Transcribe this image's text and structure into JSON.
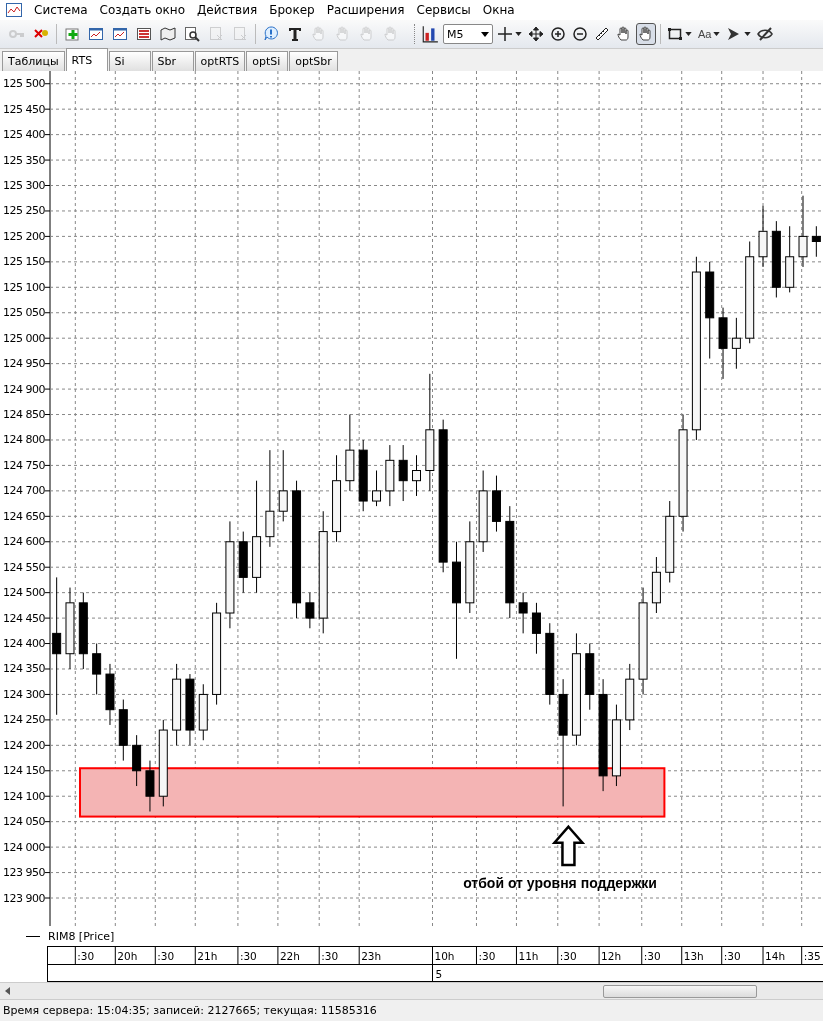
{
  "menu": [
    "Система",
    "Создать окно",
    "Действия",
    "Брокер",
    "Расширения",
    "Сервисы",
    "Окна"
  ],
  "toolbar": [
    {
      "kind": "key",
      "disabled": true
    },
    {
      "kind": "disconnect",
      "disabled": false
    },
    {
      "kind": "sep"
    },
    {
      "kind": "add",
      "disabled": false
    },
    {
      "kind": "window",
      "disabled": false
    },
    {
      "kind": "window",
      "disabled": false
    },
    {
      "kind": "list",
      "disabled": false
    },
    {
      "kind": "map",
      "disabled": false
    },
    {
      "kind": "search-doc",
      "disabled": false
    },
    {
      "kind": "doc",
      "disabled": true
    },
    {
      "kind": "doc",
      "disabled": true
    },
    {
      "kind": "sep"
    },
    {
      "kind": "alert",
      "disabled": false
    },
    {
      "kind": "text",
      "disabled": false
    },
    {
      "kind": "hand",
      "disabled": true
    },
    {
      "kind": "hand",
      "disabled": true
    },
    {
      "kind": "hand",
      "disabled": true
    },
    {
      "kind": "hand",
      "disabled": true
    }
  ],
  "chart_toolbar": {
    "timeframe": "M5",
    "tools": [
      {
        "kind": "crosshair",
        "selected": false,
        "caret": true
      },
      {
        "kind": "move",
        "selected": false,
        "caret": false
      },
      {
        "kind": "zoom-in",
        "selected": false,
        "caret": false
      },
      {
        "kind": "zoom-out",
        "selected": false,
        "caret": false
      },
      {
        "kind": "ruler",
        "selected": false,
        "caret": false
      },
      {
        "kind": "hand",
        "selected": false,
        "caret": false
      },
      {
        "kind": "hand",
        "selected": true,
        "caret": false
      },
      {
        "kind": "rect",
        "selected": false,
        "caret": true
      },
      {
        "kind": "font",
        "label": "Aa",
        "selected": false,
        "caret": true
      },
      {
        "kind": "marker",
        "selected": false,
        "caret": true
      },
      {
        "kind": "hide",
        "selected": false,
        "caret": false
      }
    ]
  },
  "tabs": [
    {
      "label": "Таблицы",
      "selected": false
    },
    {
      "label": "RTS",
      "selected": true
    },
    {
      "label": "Si",
      "selected": false
    },
    {
      "label": "Sbr",
      "selected": false
    },
    {
      "label": "optRTS",
      "selected": false
    },
    {
      "label": "optSi",
      "selected": false
    },
    {
      "label": "optSbr",
      "selected": false
    }
  ],
  "chart": {
    "legend": "RIM8 [Price]",
    "highlight": {
      "color": "#ff0000"
    },
    "time_axis": [
      ":30",
      "20h",
      ":30",
      "21h",
      ":30",
      "22h",
      ":30",
      "23h",
      "10h",
      ":30",
      "11h",
      ":30",
      "12h",
      ":30",
      "13h",
      ":30",
      "14h",
      ":35"
    ],
    "dates": [
      {
        "label": "5"
      }
    ],
    "chart_data": {
      "type": "candlestick",
      "grid": true,
      "ylim": [
        123845,
        125525
      ],
      "yticks": [
        {
          "value": 125500,
          "label": "125 500"
        },
        {
          "value": 125450,
          "label": "125 450"
        },
        {
          "value": 125400,
          "label": "125 400"
        },
        {
          "value": 125350,
          "label": "125 350"
        },
        {
          "value": 125300,
          "label": "125 300"
        },
        {
          "value": 125250,
          "label": "125 250"
        },
        {
          "value": 125200,
          "label": "125 200"
        },
        {
          "value": 125150,
          "label": "125 150"
        },
        {
          "value": 125100,
          "label": "125 100"
        },
        {
          "value": 125050,
          "label": "125 050"
        },
        {
          "value": 125000,
          "label": "125 000"
        },
        {
          "value": 124950,
          "label": "124 950"
        },
        {
          "value": 124900,
          "label": "124 900"
        },
        {
          "value": 124850,
          "label": "124 850"
        },
        {
          "value": 124800,
          "label": "124 800"
        },
        {
          "value": 124750,
          "label": "124 750"
        },
        {
          "value": 124700,
          "label": "124 700"
        },
        {
          "value": 124650,
          "label": "124 650"
        },
        {
          "value": 124600,
          "label": "124 600"
        },
        {
          "value": 124550,
          "label": "124 550"
        },
        {
          "value": 124500,
          "label": "124 500"
        },
        {
          "value": 124450,
          "label": "124 450"
        },
        {
          "value": 124400,
          "label": "124 400"
        },
        {
          "value": 124350,
          "label": "124 350"
        },
        {
          "value": 124300,
          "label": "124 300"
        },
        {
          "value": 124250,
          "label": "124 250"
        },
        {
          "value": 124200,
          "label": "124 200"
        },
        {
          "value": 124150,
          "label": "124 150"
        },
        {
          "value": 124100,
          "label": "124 100"
        },
        {
          "value": 124050,
          "label": "124 050"
        },
        {
          "value": 124000,
          "label": "124 000"
        },
        {
          "value": 123950,
          "label": "123 950"
        },
        {
          "value": 123900,
          "label": "123 900"
        }
      ],
      "categories": [
        null,
        null,
        null,
        null,
        null,
        null,
        null,
        null,
        null,
        null,
        null,
        null,
        null,
        null,
        null,
        null,
        null,
        null,
        null,
        null,
        null,
        null,
        null,
        null,
        null,
        null,
        null,
        null,
        null,
        null,
        null,
        null,
        null,
        null,
        null,
        null,
        null,
        null,
        null,
        null,
        null,
        null,
        null,
        null,
        null,
        null,
        null,
        null,
        null,
        null,
        null,
        null,
        null,
        null,
        null,
        null,
        null,
        null
      ],
      "ohlc": [
        [
          124420,
          124530,
          124260,
          124380
        ],
        [
          124380,
          124510,
          124350,
          124480
        ],
        [
          124480,
          124500,
          124350,
          124380
        ],
        [
          124380,
          124400,
          124300,
          124340
        ],
        [
          124340,
          124360,
          124240,
          124270
        ],
        [
          124270,
          124290,
          124170,
          124200
        ],
        [
          124200,
          124220,
          124120,
          124150
        ],
        [
          124150,
          124170,
          124070,
          124100
        ],
        [
          124100,
          124250,
          124080,
          124230
        ],
        [
          124230,
          124360,
          124200,
          124330
        ],
        [
          124330,
          124340,
          124200,
          124230
        ],
        [
          124230,
          124320,
          124210,
          124300
        ],
        [
          124300,
          124480,
          124280,
          124460
        ],
        [
          124460,
          124640,
          124430,
          124600
        ],
        [
          124600,
          124620,
          124500,
          124530
        ],
        [
          124530,
          124720,
          124500,
          124610
        ],
        [
          124610,
          124780,
          124590,
          124660
        ],
        [
          124660,
          124780,
          124640,
          124700
        ],
        [
          124700,
          124720,
          124450,
          124480
        ],
        [
          124480,
          124500,
          124430,
          124450
        ],
        [
          124450,
          124660,
          124420,
          124620
        ],
        [
          124620,
          124770,
          124600,
          124720
        ],
        [
          124720,
          124850,
          124700,
          124780
        ],
        [
          124780,
          124800,
          124660,
          124680
        ],
        [
          124680,
          124740,
          124670,
          124700
        ],
        [
          124700,
          124790,
          124670,
          124760
        ],
        [
          124760,
          124790,
          124680,
          124720
        ],
        [
          124720,
          124770,
          124690,
          124740
        ],
        [
          124740,
          124930,
          124700,
          124820
        ],
        [
          124820,
          124840,
          124540,
          124560
        ],
        [
          124560,
          124600,
          124370,
          124480
        ],
        [
          124480,
          124640,
          124460,
          124600
        ],
        [
          124600,
          124740,
          124580,
          124700
        ],
        [
          124700,
          124730,
          124620,
          124640
        ],
        [
          124640,
          124670,
          124450,
          124480
        ],
        [
          124480,
          124500,
          124420,
          124460
        ],
        [
          124460,
          124480,
          124380,
          124420
        ],
        [
          124420,
          124440,
          124280,
          124300
        ],
        [
          124300,
          124330,
          124080,
          124220
        ],
        [
          124220,
          124420,
          124200,
          124380
        ],
        [
          124380,
          124400,
          124270,
          124300
        ],
        [
          124300,
          124330,
          124110,
          124140
        ],
        [
          124140,
          124280,
          124120,
          124250
        ],
        [
          124250,
          124360,
          124230,
          124330
        ],
        [
          124330,
          124510,
          124300,
          124480
        ],
        [
          124480,
          124570,
          124460,
          124540
        ],
        [
          124540,
          124680,
          124520,
          124650
        ],
        [
          124650,
          124850,
          124620,
          124820
        ],
        [
          124820,
          125160,
          124800,
          125130
        ],
        [
          125130,
          125150,
          124960,
          125040
        ],
        [
          125040,
          125060,
          124920,
          124980
        ],
        [
          124980,
          125040,
          124940,
          125000
        ],
        [
          125000,
          125190,
          124990,
          125160
        ],
        [
          125160,
          125260,
          125140,
          125210
        ],
        [
          125210,
          125230,
          125080,
          125100
        ],
        [
          125100,
          125220,
          125090,
          125160
        ],
        [
          125160,
          125280,
          125140,
          125200
        ],
        [
          125200,
          125220,
          125160,
          125190
        ]
      ],
      "annotations": [
        "отбой от уровня поддержки"
      ]
    }
  },
  "status_bar": "Время сервера: 15:04:35; записей: 2127665; текущая: 11585316"
}
